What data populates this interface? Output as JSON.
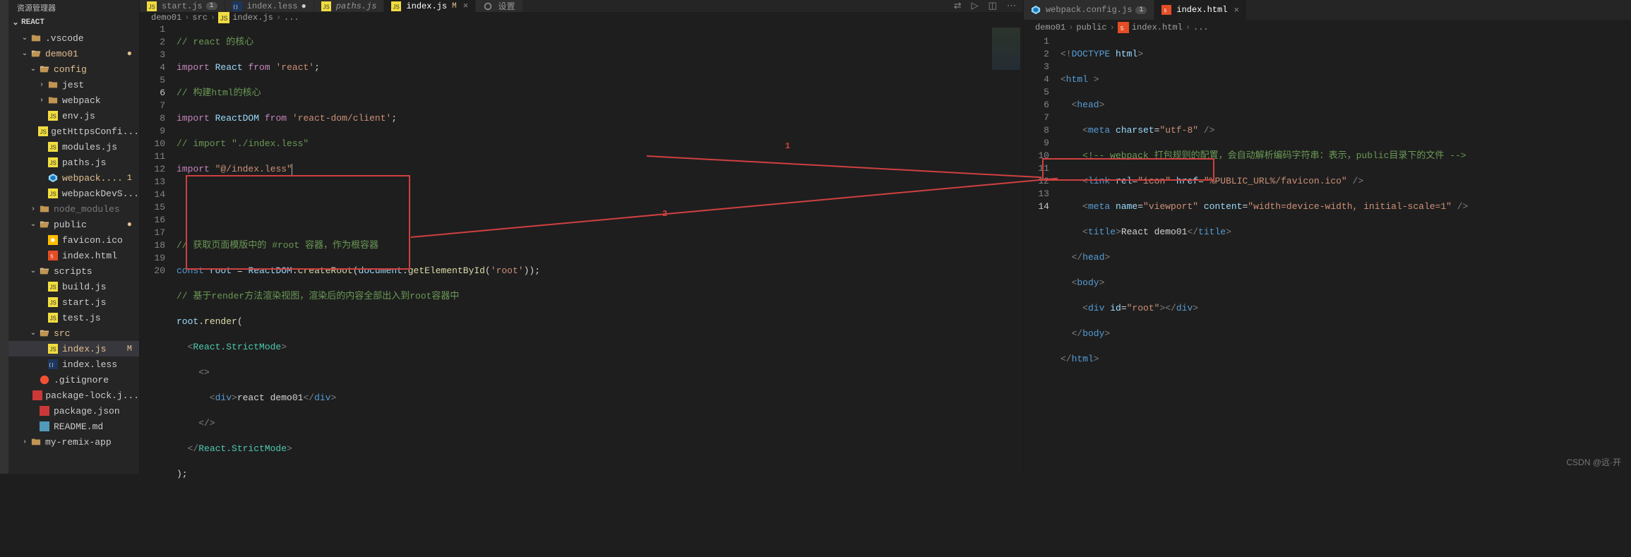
{
  "sidebar": {
    "title": "资源管理器",
    "root_label": "REACT",
    "tree": [
      {
        "indent": 1,
        "chev": "down",
        "icon": "folder",
        "label": ".vscode",
        "color": "#cccccc"
      },
      {
        "indent": 1,
        "chev": "down",
        "icon": "folder-open",
        "label": "demo01",
        "color": "#e2c08d",
        "mod": "●",
        "git": true
      },
      {
        "indent": 2,
        "chev": "down",
        "icon": "folder-open",
        "label": "config",
        "color": "#e2c08d",
        "git": true
      },
      {
        "indent": 3,
        "chev": "right",
        "icon": "folder",
        "label": "jest",
        "color": "#cccccc"
      },
      {
        "indent": 3,
        "chev": "right",
        "icon": "folder",
        "label": "webpack",
        "color": "#cccccc"
      },
      {
        "indent": 3,
        "icon": "js",
        "label": "env.js",
        "color": "#cccccc"
      },
      {
        "indent": 3,
        "icon": "js",
        "label": "getHttpsConfi...",
        "color": "#cccccc"
      },
      {
        "indent": 3,
        "icon": "js",
        "label": "modules.js",
        "color": "#cccccc"
      },
      {
        "indent": 3,
        "icon": "js",
        "label": "paths.js",
        "color": "#cccccc"
      },
      {
        "indent": 3,
        "icon": "webpack",
        "label": "webpack....",
        "color": "#e2c08d",
        "mod": "1",
        "git": true
      },
      {
        "indent": 3,
        "icon": "js",
        "label": "webpackDevS...",
        "color": "#cccccc"
      },
      {
        "indent": 2,
        "chev": "right",
        "icon": "folder",
        "label": "node_modules",
        "color": "#7a7a7a"
      },
      {
        "indent": 2,
        "chev": "down",
        "icon": "folder-open",
        "label": "public",
        "color": "#cccccc",
        "mod": "●"
      },
      {
        "indent": 3,
        "icon": "favicon",
        "label": "favicon.ico",
        "color": "#cccccc"
      },
      {
        "indent": 3,
        "icon": "html",
        "label": "index.html",
        "color": "#cccccc"
      },
      {
        "indent": 2,
        "chev": "down",
        "icon": "folder-open",
        "label": "scripts",
        "color": "#cccccc"
      },
      {
        "indent": 3,
        "icon": "js",
        "label": "build.js",
        "color": "#cccccc"
      },
      {
        "indent": 3,
        "icon": "js",
        "label": "start.js",
        "color": "#cccccc"
      },
      {
        "indent": 3,
        "icon": "js",
        "label": "test.js",
        "color": "#cccccc"
      },
      {
        "indent": 2,
        "chev": "down",
        "icon": "folder-open",
        "label": "src",
        "color": "#e2c08d",
        "git": true
      },
      {
        "indent": 3,
        "icon": "js",
        "label": "index.js",
        "color": "#e2c08d",
        "mod": "M",
        "git": true,
        "selected": true
      },
      {
        "indent": 3,
        "icon": "less",
        "label": "index.less",
        "color": "#cccccc"
      },
      {
        "indent": 2,
        "icon": "git",
        "label": ".gitignore",
        "color": "#cccccc"
      },
      {
        "indent": 2,
        "icon": "npm",
        "label": "package-lock.j...",
        "color": "#cccccc"
      },
      {
        "indent": 2,
        "icon": "npm",
        "label": "package.json",
        "color": "#cccccc"
      },
      {
        "indent": 2,
        "icon": "readme",
        "label": "README.md",
        "color": "#cccccc"
      },
      {
        "indent": 1,
        "chev": "right",
        "icon": "folder",
        "label": "my-remix-app",
        "color": "#cccccc"
      }
    ]
  },
  "left_editor": {
    "tabs": [
      {
        "icon": "js",
        "label": "start.js",
        "badge": "1"
      },
      {
        "icon": "less",
        "label": "index.less",
        "dirty": true
      },
      {
        "icon": "js",
        "label": "paths.js",
        "italic": true
      },
      {
        "icon": "js",
        "label": "index.js",
        "git": "M",
        "active": true,
        "close": true
      },
      {
        "icon": "gear",
        "label": "设置"
      }
    ],
    "tabs_actions": [
      "compare",
      "run",
      "split",
      "more"
    ],
    "breadcrumb": [
      "demo01",
      "src",
      "index.js",
      "..."
    ],
    "breadcrumb_icons": [
      "",
      "",
      "js",
      ""
    ],
    "lines_count": 20,
    "active_line": 6,
    "annotations": {
      "label1": "1",
      "label2": "2"
    }
  },
  "right_editor": {
    "tabs": [
      {
        "icon": "webpack",
        "label": "webpack.config.js",
        "badge": "1"
      },
      {
        "icon": "html",
        "label": "index.html",
        "active": true,
        "close": true
      }
    ],
    "breadcrumb": [
      "demo01",
      "public",
      "index.html",
      "..."
    ],
    "breadcrumb_icons": [
      "",
      "",
      "html",
      ""
    ],
    "lines_count": 14,
    "active_line": 14
  },
  "code_left": {
    "l1": "// react 的核心",
    "l2_a": "import",
    "l2_b": "React",
    "l2_c": "from",
    "l2_d": "'react'",
    "l2_e": ";",
    "l3": "// 构建html的核心",
    "l4_a": "import",
    "l4_b": "ReactDOM",
    "l4_c": "from",
    "l4_d": "'react-dom/client'",
    "l4_e": ";",
    "l5": "// import \"./index.less\"",
    "l6_a": "import",
    "l6_b": "\"@/index.less\"",
    "l9": "// 获取页面模版中的 #root 容器，作为根容器",
    "l10_a": "const",
    "l10_b": "root",
    "l10_c": " = ",
    "l10_d": "ReactDOM",
    "l10_e": ".",
    "l10_f": "createRoot",
    "l10_g": "(",
    "l10_h": "document",
    "l10_i": ".",
    "l10_j": "getElementById",
    "l10_k": "(",
    "l10_l": "'root'",
    "l10_m": "));",
    "l11": "// 基于render方法渲染视图，渲染后的内容全部出入到root容器中",
    "l12_a": "root",
    "l12_b": ".",
    "l12_c": "render",
    "l12_d": "(",
    "l13_a": "  <",
    "l13_b": "React.StrictMode",
    "l13_c": ">",
    "l14": "    <>",
    "l15_a": "      <",
    "l15_b": "div",
    "l15_c": ">",
    "l15_d": "react demo01",
    "l15_e": "</",
    "l15_f": "div",
    "l15_g": ">",
    "l16": "    </>",
    "l17_a": "  </",
    "l17_b": "React.StrictMode",
    "l17_c": ">",
    "l18": ");"
  },
  "code_right": {
    "l1_a": "<!",
    "l1_b": "DOCTYPE",
    "l1_c": " ",
    "l1_d": "html",
    "l1_e": ">",
    "l2_a": "<",
    "l2_b": "html",
    "l2_c": " >",
    "l3_a": "  <",
    "l3_b": "head",
    "l3_c": ">",
    "l4_a": "    <",
    "l4_b": "meta",
    "l4_c": " ",
    "l4_d": "charset",
    "l4_e": "=",
    "l4_f": "\"utf-8\"",
    "l4_g": " />",
    "l5": "    <!-- webpack 打包规则的配置，会自动解析编码字符串：表示，public目录下的文件 -->",
    "l6_a": "    <",
    "l6_b": "link",
    "l6_c": " ",
    "l6_d": "rel",
    "l6_e": "=",
    "l6_f": "\"icon\"",
    "l6_g": " ",
    "l6_h": "href",
    "l6_i": "=",
    "l6_j": "\"%PUBLIC_URL%/favicon.ico\"",
    "l6_k": " />",
    "l7_a": "    <",
    "l7_b": "meta",
    "l7_c": " ",
    "l7_d": "name",
    "l7_e": "=",
    "l7_f": "\"viewport\"",
    "l7_g": " ",
    "l7_h": "content",
    "l7_i": "=",
    "l7_j": "\"width=device-width, initial-scale=1\"",
    "l7_k": " />",
    "l8_a": "    <",
    "l8_b": "title",
    "l8_c": ">",
    "l8_d": "React demo01",
    "l8_e": "</",
    "l8_f": "title",
    "l8_g": ">",
    "l9_a": "  </",
    "l9_b": "head",
    "l9_c": ">",
    "l10_a": "  <",
    "l10_b": "body",
    "l10_c": ">",
    "l11_a": "    <",
    "l11_b": "div",
    "l11_c": " ",
    "l11_d": "id",
    "l11_e": "=",
    "l11_f": "\"root\"",
    "l11_g": "></",
    "l11_h": "div",
    "l11_i": ">",
    "l12_a": "  </",
    "l12_b": "body",
    "l12_c": ">",
    "l13_a": "</",
    "l13_b": "html",
    "l13_c": ">"
  },
  "watermark": "CSDN @远·开"
}
